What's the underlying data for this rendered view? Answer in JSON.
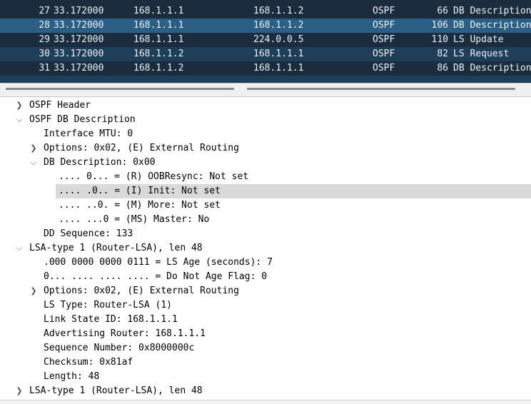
{
  "packets": [
    {
      "no": "27",
      "time": "33.172000",
      "src": "168.1.1.1",
      "dst": "168.1.1.2",
      "proto": "OSPF",
      "len": "66",
      "info": "DB Description"
    },
    {
      "no": "28",
      "time": "33.172000",
      "src": "168.1.1.1",
      "dst": "168.1.1.2",
      "proto": "OSPF",
      "len": "106",
      "info": "DB Description"
    },
    {
      "no": "29",
      "time": "33.172000",
      "src": "168.1.1.1",
      "dst": "224.0.0.5",
      "proto": "OSPF",
      "len": "110",
      "info": "LS Update"
    },
    {
      "no": "30",
      "time": "33.172000",
      "src": "168.1.1.2",
      "dst": "168.1.1.1",
      "proto": "OSPF",
      "len": "82",
      "info": "LS Request"
    },
    {
      "no": "31",
      "time": "33.172000",
      "src": "168.1.1.2",
      "dst": "168.1.1.1",
      "proto": "OSPF",
      "len": "86",
      "info": "DB Description"
    }
  ],
  "details": {
    "ospf_header": "OSPF Header",
    "db_desc": "OSPF DB Description",
    "iface_mtu": "Interface MTU: 0",
    "options1": "Options: 0x02, (E) External Routing",
    "db_description": "DB Description: 0x00",
    "oobresync": ".... 0... = (R) OOBResync: Not set",
    "init": ".... .0.. = (I) Init: Not set",
    "more": ".... ..0. = (M) More: Not set",
    "master": ".... ...0 = (MS) Master: No",
    "dd_seq": "DD Sequence: 133",
    "lsa1": "LSA-type 1 (Router-LSA), len 48",
    "ls_age": ".000 0000 0000 0111 = LS Age (seconds): 7",
    "dna": "0... .... .... .... = Do Not Age Flag: 0",
    "options2": "Options: 0x02, (E) External Routing",
    "ls_type": "LS Type: Router-LSA (1)",
    "link_state_id": "Link State ID: 168.1.1.1",
    "adv_router": "Advertising Router: 168.1.1.1",
    "seq_num": "Sequence Number: 0x8000000c",
    "checksum": "Checksum: 0x81af",
    "length": "Length: 48",
    "lsa2": "LSA-type 1 (Router-LSA), len 48"
  },
  "icons": {
    "collapsed": "chevron-right-icon",
    "expanded": "chevron-down-icon"
  },
  "colors": {
    "list_bg": "#1a2c3e",
    "list_alt": "#1f3e58",
    "list_selected": "#2b5f86",
    "tree_highlight": "#d9d9d9"
  }
}
